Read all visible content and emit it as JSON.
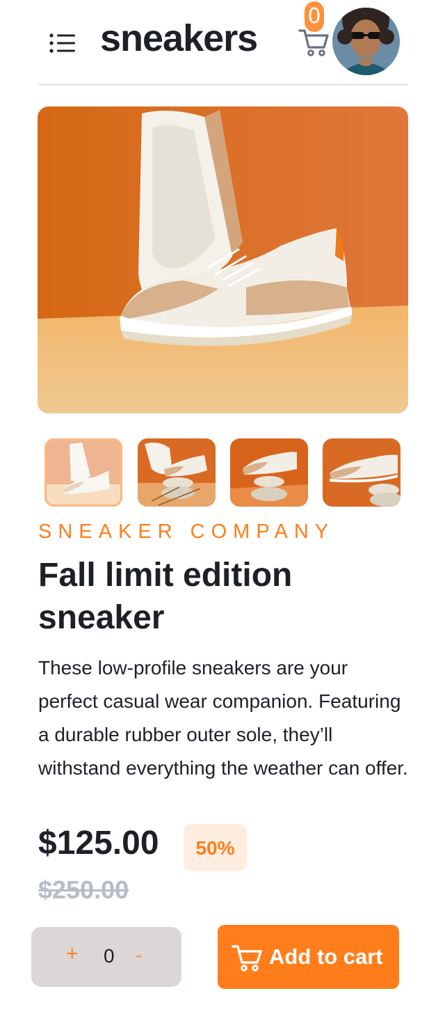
{
  "header": {
    "brand": "sneakers",
    "cart_count": "0",
    "icons": {
      "menu": "hamburger-menu-icon",
      "cart": "cart-icon",
      "avatar": "user-avatar"
    }
  },
  "gallery": {
    "selected_index": 0,
    "thumb_count": 4
  },
  "product": {
    "company": "SNEAKER COMPANY",
    "title": "Fall limit edition sneaker",
    "description": "These low-profile sneakers are your perfect casual wear companion. Featuring a durable rubber outer sole, they’ll withstand everything the weather can offer.",
    "price": "$125.00",
    "discount": "50%",
    "original_price": "$250.00"
  },
  "cart_controls": {
    "plus": "+",
    "quantity": "0",
    "minus": "-",
    "add_label": "Add to cart"
  },
  "colors": {
    "accent": "#ff7e1b",
    "accent_pale": "#ffede0",
    "text_dark": "#1d2026",
    "muted": "#b6bcc8",
    "quantity_bg": "#dcd6d6"
  }
}
